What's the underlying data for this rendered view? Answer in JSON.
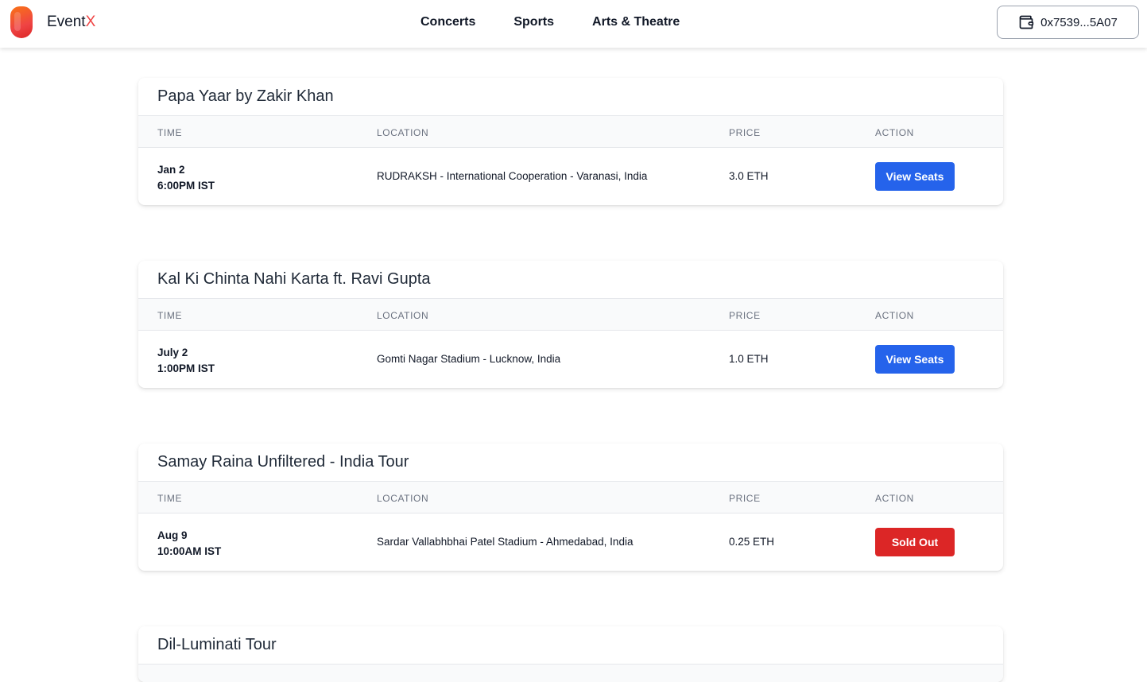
{
  "header": {
    "brand_main": "Event",
    "brand_accent": "X",
    "nav": [
      "Concerts",
      "Sports",
      "Arts & Theatre"
    ],
    "wallet_address": "0x7539...5A07"
  },
  "table_headers": {
    "time": "TIME",
    "location": "LOCATION",
    "price": "PRICE",
    "action": "ACTION"
  },
  "events": [
    {
      "title": "Papa Yaar by Zakir Khan",
      "date": "Jan 2",
      "time": "6:00PM IST",
      "location": "RUDRAKSH - International Cooperation - Varanasi, India",
      "price": "3.0 ETH",
      "action": "View Seats"
    },
    {
      "title": "Kal Ki Chinta Nahi Karta ft. Ravi Gupta",
      "date": "July 2",
      "time": "1:00PM IST",
      "location": "Gomti Nagar Stadium - Lucknow, India",
      "price": "1.0 ETH",
      "action": "View Seats"
    },
    {
      "title": "Samay Raina Unfiltered - India Tour",
      "date": "Aug 9",
      "time": "10:00AM IST",
      "location": "Sardar Vallabhbhai Patel Stadium - Ahmedabad, India",
      "price": "0.25 ETH",
      "action": "Sold Out"
    },
    {
      "title": "Dil-Luminati Tour"
    }
  ],
  "colors": {
    "primary_button": "#2563eb",
    "sold_out_button": "#dc2626",
    "brand_accent": "#ef4444"
  }
}
